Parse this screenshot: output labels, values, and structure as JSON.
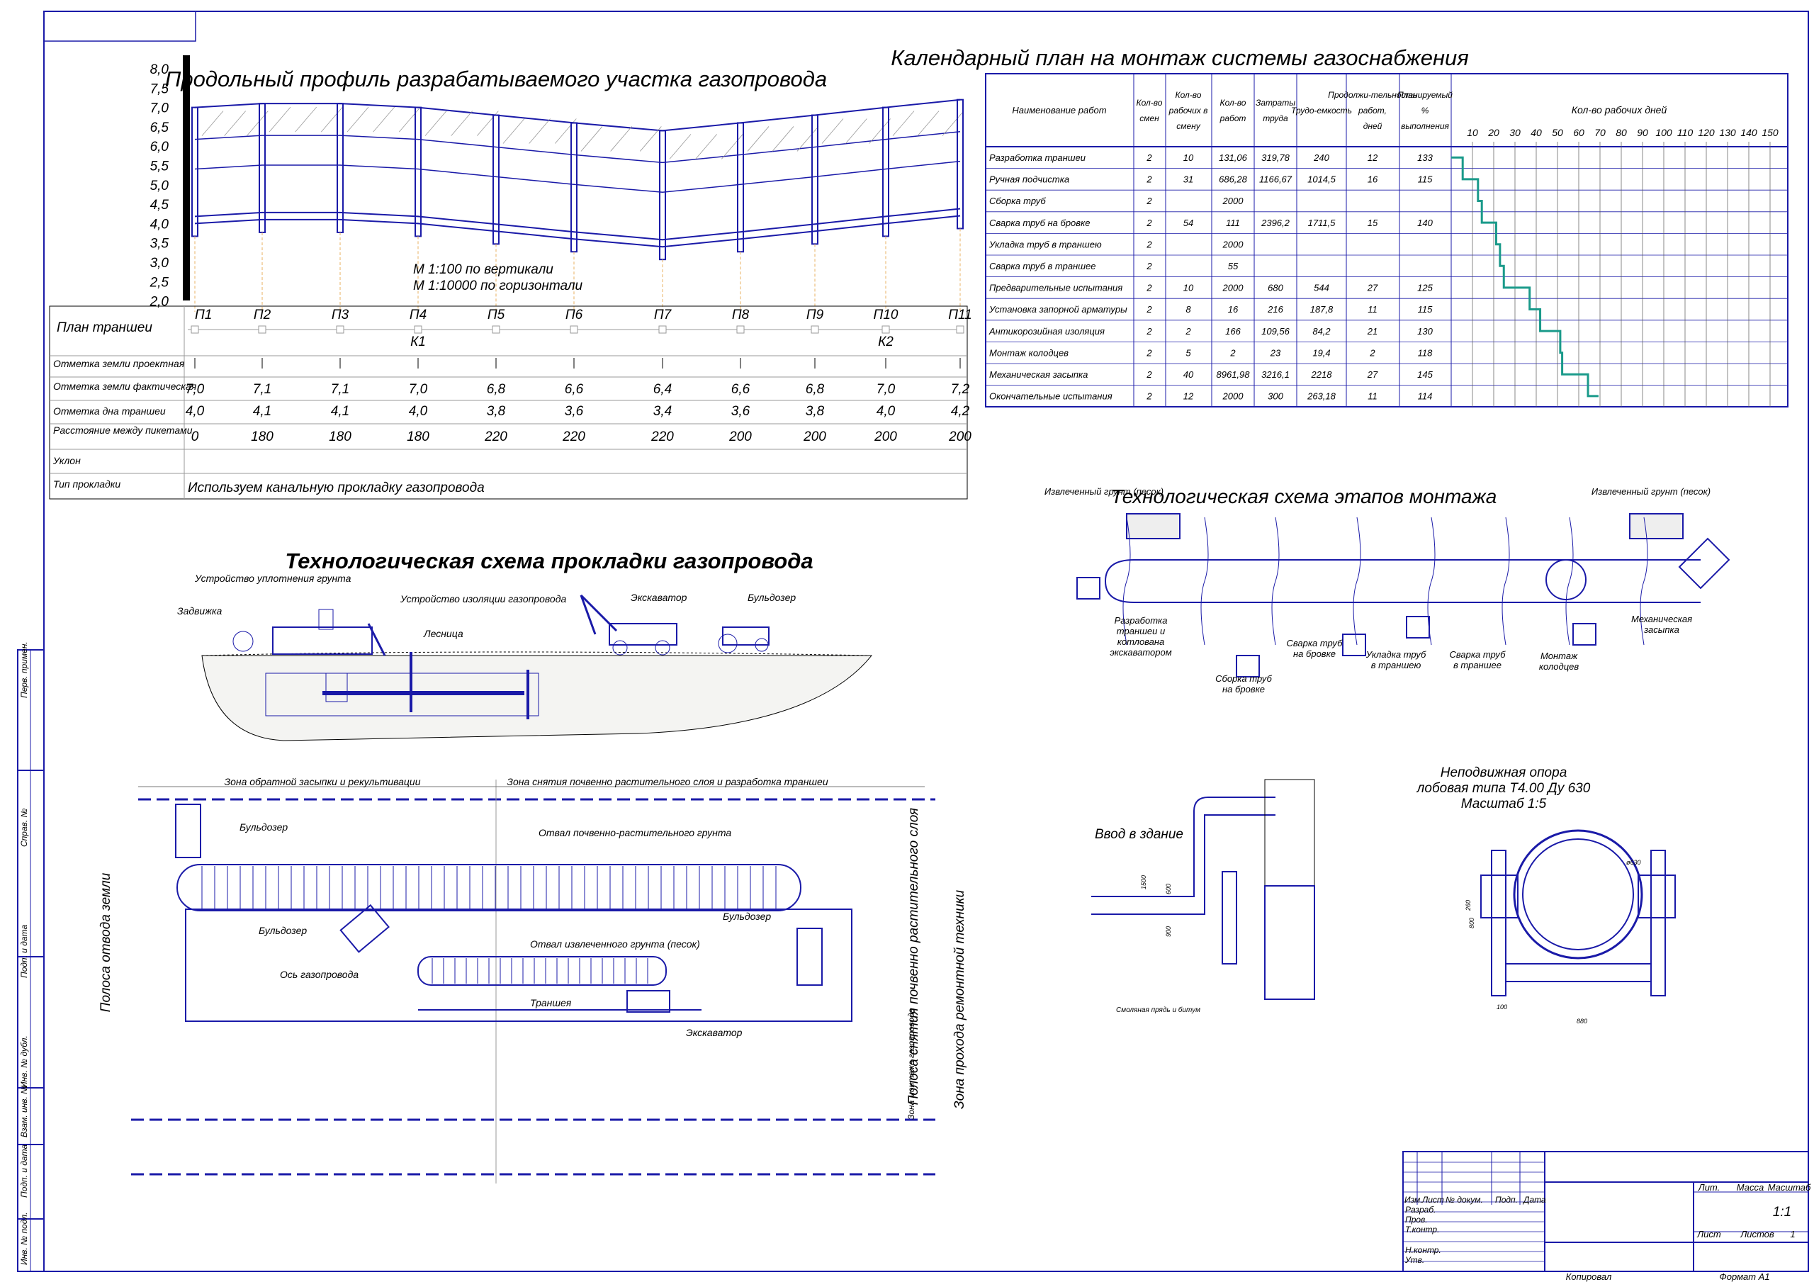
{
  "profile": {
    "title": "Продольный профиль разрабатываемого участка газопровода",
    "scale_vertical": "М 1:100 по вертикали",
    "scale_horizontal": "М 1:10000 по горизонтали",
    "y_ticks": [
      "8,0",
      "7,5",
      "7,0",
      "6,5",
      "6,0",
      "5,5",
      "5,0",
      "4,5",
      "4,0",
      "3,5",
      "3,0",
      "2,5",
      "2,0"
    ],
    "plan_label": "План траншеи",
    "pickets": [
      "П1",
      "П2",
      "П3",
      "П4",
      "П5",
      "П6",
      "П7",
      "П8",
      "П9",
      "П10",
      "П11"
    ],
    "wells": [
      "К1",
      "К2"
    ],
    "rows": {
      "design_label": "Отметка земли проектная",
      "actual_label": "Отметка земли фактическая",
      "bottom_label": "Отметка дна траншеи",
      "distance_label": "Расстояние между пикетами",
      "slope_label": "Уклон",
      "laying_label": "Тип прокладки",
      "laying_value": "Используем канальную прокладку газопровода"
    },
    "actual_values": [
      "7,0",
      "7,1",
      "7,1",
      "7,0",
      "6,8",
      "6,6",
      "6,4",
      "6,6",
      "6,8",
      "7,0",
      "7,2"
    ],
    "bottom_values": [
      "4,0",
      "4,1",
      "4,1",
      "4,0",
      "3,8",
      "3,6",
      "3,4",
      "3,6",
      "3,8",
      "4,0",
      "4,2"
    ],
    "distance_values": [
      "0",
      "180",
      "180",
      "180",
      "220",
      "220",
      "220",
      "200",
      "200",
      "200",
      "200"
    ]
  },
  "calendar": {
    "title": "Календарный план на монтаж системы газоснабжения",
    "headers": [
      "Наименование работ",
      "Кол-во смен",
      "Кол-во рабочих в смену",
      "Кол-во работ",
      "Затраты труда",
      "Трудо-емкость",
      "Продолжи-тельность работ, дней",
      "Планируемый % выполнения"
    ],
    "days_label": "Кол-во рабочих дней",
    "day_ticks": [
      "10",
      "20",
      "30",
      "40",
      "50",
      "60",
      "70",
      "80",
      "90",
      "100",
      "110",
      "120",
      "130",
      "140",
      "150"
    ],
    "rows": [
      [
        "Разработка траншеи",
        "2",
        "10",
        "131,06",
        "319,78",
        "240",
        "12",
        "133"
      ],
      [
        "Ручная подчистка",
        "2",
        "31",
        "686,28",
        "1166,67",
        "1014,5",
        "16",
        "115"
      ],
      [
        "Сборка труб",
        "2",
        "",
        "2000",
        "",
        "",
        "",
        ""
      ],
      [
        "Сварка труб на бровке",
        "2",
        "54",
        "111",
        "2396,2",
        "1711,5",
        "15",
        "140"
      ],
      [
        "Укладка труб в траншею",
        "2",
        "",
        "2000",
        "",
        "",
        "",
        ""
      ],
      [
        "Сварка труб в траншее",
        "2",
        "",
        "55",
        "",
        "",
        "",
        ""
      ],
      [
        "Предварительные испытания",
        "2",
        "10",
        "2000",
        "680",
        "544",
        "27",
        "125"
      ],
      [
        "Установка запорной арматуры",
        "2",
        "8",
        "16",
        "216",
        "187,8",
        "11",
        "115"
      ],
      [
        "Антикорозийная изоляция",
        "2",
        "2",
        "166",
        "109,56",
        "84,2",
        "21",
        "130"
      ],
      [
        "Монтаж колодцев",
        "2",
        "5",
        "2",
        "23",
        "19,4",
        "2",
        "118"
      ],
      [
        "Механическая засыпка",
        "2",
        "40",
        "8961,98",
        "3216,1",
        "2218",
        "27",
        "145"
      ],
      [
        "Окончательные испытания",
        "2",
        "12",
        "2000",
        "300",
        "263,18",
        "11",
        "114"
      ]
    ]
  },
  "laying": {
    "title": "Технологическая схема прокладки газопровода",
    "labels": [
      "Устройство уплотнения грунта",
      "Задвижка",
      "Устройство изоляции газопровода",
      "Лесница",
      "Экскаватор",
      "Бульдозер"
    ]
  },
  "stages": {
    "title": "Технологическая схема этапов монтажа",
    "soil_left": "Извлеченный грунт (песок)",
    "soil_right": "Извлеченный грунт (песок)",
    "steps": [
      "Разработка траншеи и котлована экскаватором",
      "Сборка труб на бровке",
      "Сварка труб на бровке",
      "Укладка труб в траншею",
      "Сварка труб в траншее",
      "Монтаж колодцев",
      "Механическая засыпка"
    ]
  },
  "plan": {
    "zone_left": "Зона обратной засыпки и рекультивации",
    "zone_right": "Зона снятия почвенно растительного слоя и разработка траншеи",
    "strip_remove": "Полоса снятия почвенно растительного слоя",
    "strip_allot": "Полоса отвода земли",
    "zone_mount": "Зона монтажа газопровода",
    "zone_pass": "Зона прохода ремонтной техники",
    "dump_top": "Отвал почвенно-растительного грунта",
    "dump_mid": "Отвал извлеченного грунта (песок)",
    "axis": "Ось газопровода",
    "trench": "Траншея",
    "bulldozer": "Бульдозер",
    "excavator": "Экскаватор"
  },
  "entry": {
    "title": "Ввод в здание",
    "dims": [
      "1500",
      "600",
      "900"
    ],
    "note": "Смоляная прядь и битум"
  },
  "support": {
    "title_line1": "Неподвижная опора",
    "title_line2": "лобовая типа Т4.00 Ду 630",
    "title_line3": "Масштаб 1:5",
    "dims": [
      "ø630",
      "260",
      "800",
      "100",
      "880"
    ]
  },
  "side_stamp": [
    "Перв. примен.",
    "Справ. №",
    "Подп. и дата",
    "Инв. № дубл.",
    "Взам. инв. №",
    "Подп. и дата",
    "Инв. № подл."
  ],
  "title_block": {
    "cols": [
      "Изм.",
      "Лист",
      "№ докум.",
      "Подп.",
      "Дата"
    ],
    "roles": [
      "Разраб.",
      "Пров.",
      "Т.контр.",
      "Н.контр.",
      "Утв."
    ],
    "lit": "Лит.",
    "mass": "Масса",
    "scale_label": "Масштаб",
    "scale_value": "1:1",
    "sheet": "Лист",
    "sheets": "Листов",
    "sheets_value": "1",
    "copied": "Копировал",
    "format": "Формат А1"
  }
}
